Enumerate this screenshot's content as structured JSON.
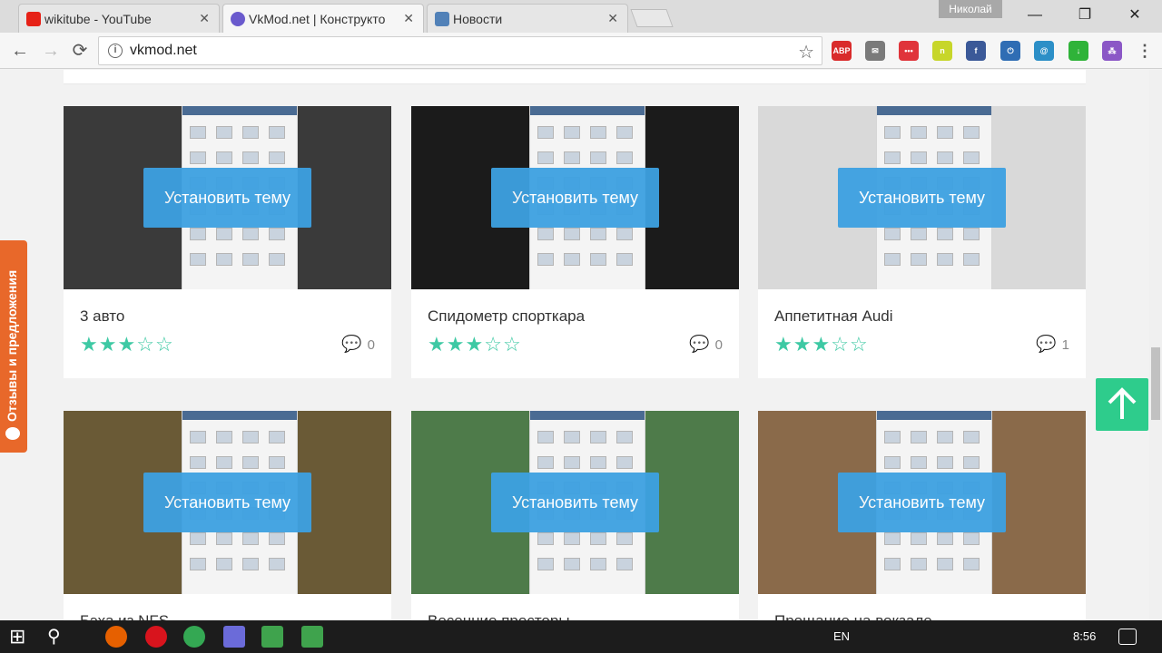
{
  "browser": {
    "tabs": [
      {
        "title": "wikitube - YouTube",
        "favicon_color": "#e62117",
        "state": "inactive"
      },
      {
        "title": "VkMod.net | Конструкто",
        "favicon_color": "#6a5acd",
        "state": "active"
      },
      {
        "title": "Новости",
        "favicon_color": "#5181b8",
        "state": "inactive"
      }
    ],
    "tab_close_glyph": "✕",
    "user_name": "Николай",
    "window_controls": {
      "minimize": "—",
      "maximize": "❐",
      "close": "✕"
    },
    "nav": {
      "back": "←",
      "forward": "→",
      "reload": "⟳"
    },
    "address": {
      "info_glyph": "i",
      "url": "vkmod.net",
      "star_glyph": "☆"
    },
    "extensions": [
      {
        "name": "adblock-plus-icon",
        "label": "ABP",
        "color": "#d92b2b"
      },
      {
        "name": "mail-icon",
        "label": "✉",
        "color": "#7a7a7a"
      },
      {
        "name": "extension-dots-icon",
        "label": "•••",
        "color": "#e0343a"
      },
      {
        "name": "extension-n-icon",
        "label": "n",
        "color": "#c7d62a"
      },
      {
        "name": "facebook-icon",
        "label": "f",
        "color": "#3b5998"
      },
      {
        "name": "power-icon",
        "label": "⏻",
        "color": "#2f6db4"
      },
      {
        "name": "at-sign-icon",
        "label": "@",
        "color": "#2c8fc7"
      },
      {
        "name": "download-arrow-icon",
        "label": "↓",
        "color": "#2fb339"
      },
      {
        "name": "colorful-dots-icon",
        "label": "⁂",
        "color": "#8b57c6"
      },
      {
        "name": "menu-icon",
        "label": "⋮",
        "color": "#f6f6f6"
      }
    ]
  },
  "page": {
    "install_label": "Установить тему",
    "feedback_label": "Отзывы и предложения",
    "scroll_top_label": "↑",
    "accent": "#3da1e2",
    "star_color": "#3ec9a4",
    "themes": [
      {
        "title": "3 авто",
        "rating": 3,
        "max": 5,
        "comments": "0",
        "bg": "#3a3a3a"
      },
      {
        "title": "Спидометр спорткара",
        "rating": 3,
        "max": 5,
        "comments": "0",
        "bg": "#1b1b1b"
      },
      {
        "title": "Аппетитная Audi",
        "rating": 3,
        "max": 5,
        "comments": "1",
        "bg": "#d9d9d9"
      },
      {
        "title": "Бэха из NFS",
        "rating": 0,
        "max": 5,
        "comments": "",
        "bg": "#6a5a36"
      },
      {
        "title": "Весенние просторы",
        "rating": 0,
        "max": 5,
        "comments": "",
        "bg": "#4e7b4a"
      },
      {
        "title": "Прощание на вокзале",
        "rating": 0,
        "max": 5,
        "comments": "",
        "bg": "#8a6a4a"
      }
    ]
  },
  "taskbar": {
    "language": "EN",
    "time": "8:56",
    "apps": [
      {
        "name": "windows-start-icon",
        "color": "#1c1c1c"
      },
      {
        "name": "search-icon",
        "color": "#1c1c1c"
      },
      {
        "name": "firefox-icon",
        "color": "#e66000"
      },
      {
        "name": "opera-icon",
        "color": "#d8141d"
      },
      {
        "name": "chrome-icon",
        "color": "#34a853"
      },
      {
        "name": "save-app-icon",
        "color": "#6b6bd9"
      },
      {
        "name": "camtasia-icon",
        "color": "#3fa34d"
      },
      {
        "name": "camtasia-recorder-icon",
        "color": "#3fa34d"
      }
    ]
  }
}
